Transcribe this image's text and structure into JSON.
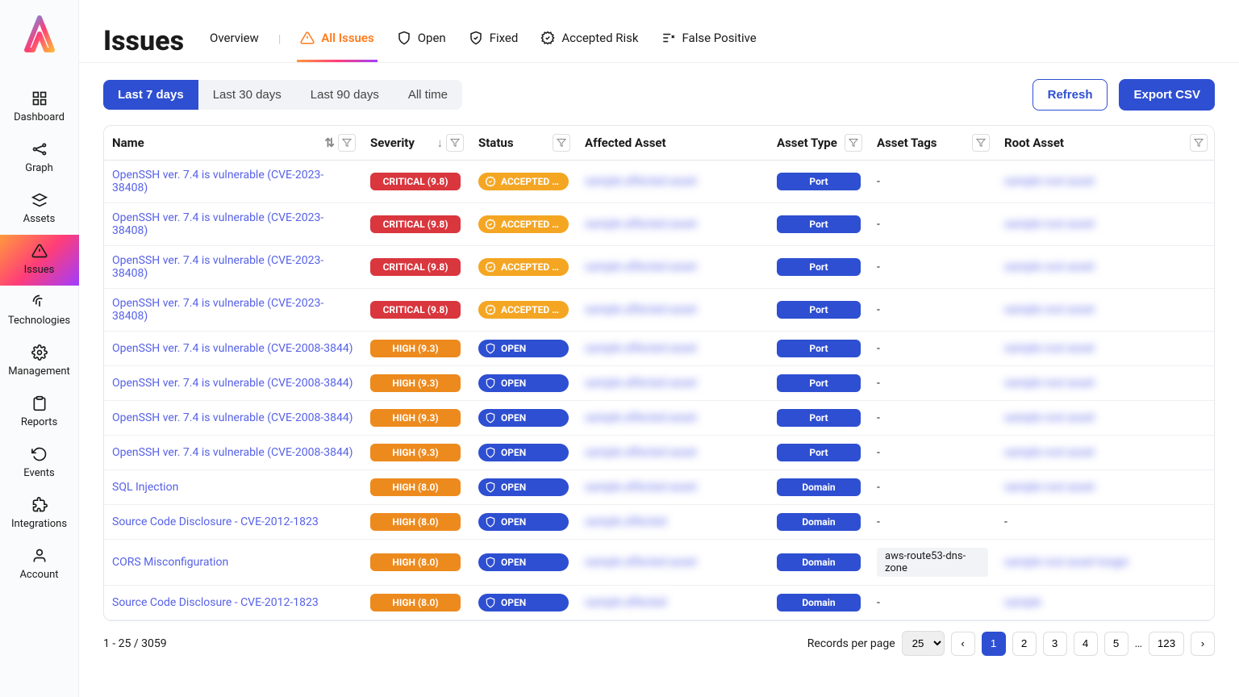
{
  "sidebar": {
    "items": [
      {
        "label": "Dashboard"
      },
      {
        "label": "Graph"
      },
      {
        "label": "Assets"
      },
      {
        "label": "Issues"
      },
      {
        "label": "Technologies"
      },
      {
        "label": "Management"
      },
      {
        "label": "Reports"
      },
      {
        "label": "Events"
      },
      {
        "label": "Integrations"
      },
      {
        "label": "Account"
      }
    ]
  },
  "page": {
    "title": "Issues"
  },
  "tabs": [
    {
      "label": "Overview"
    },
    {
      "label": "All Issues",
      "active": true
    },
    {
      "label": "Open"
    },
    {
      "label": "Fixed"
    },
    {
      "label": "Accepted Risk"
    },
    {
      "label": "False Positive"
    }
  ],
  "timefilters": [
    {
      "label": "Last 7 days",
      "active": true
    },
    {
      "label": "Last 30 days"
    },
    {
      "label": "Last 90 days"
    },
    {
      "label": "All time"
    }
  ],
  "buttons": {
    "refresh": "Refresh",
    "export": "Export CSV"
  },
  "columns": {
    "name": "Name",
    "severity": "Severity",
    "status": "Status",
    "affected": "Affected Asset",
    "asset_type": "Asset Type",
    "tags": "Asset Tags",
    "root": "Root Asset"
  },
  "rows": [
    {
      "name": "OpenSSH ver. 7.4 is vulnerable (CVE-2023-38408)",
      "sev": "CRITICAL (9.8)",
      "sevc": "crit",
      "status": "ACCEPTED …",
      "statc": "acc",
      "aff": "sample affected asset",
      "atype": "Port",
      "tags": "-",
      "root": "sample root asset"
    },
    {
      "name": "OpenSSH ver. 7.4 is vulnerable (CVE-2023-38408)",
      "sev": "CRITICAL (9.8)",
      "sevc": "crit",
      "status": "ACCEPTED …",
      "statc": "acc",
      "aff": "sample affected asset",
      "atype": "Port",
      "tags": "-",
      "root": "sample root asset"
    },
    {
      "name": "OpenSSH ver. 7.4 is vulnerable (CVE-2023-38408)",
      "sev": "CRITICAL (9.8)",
      "sevc": "crit",
      "status": "ACCEPTED …",
      "statc": "acc",
      "aff": "sample affected asset",
      "atype": "Port",
      "tags": "-",
      "root": "sample root asset"
    },
    {
      "name": "OpenSSH ver. 7.4 is vulnerable (CVE-2023-38408)",
      "sev": "CRITICAL (9.8)",
      "sevc": "crit",
      "status": "ACCEPTED …",
      "statc": "acc",
      "aff": "sample affected asset",
      "atype": "Port",
      "tags": "-",
      "root": "sample root asset"
    },
    {
      "name": "OpenSSH ver. 7.4 is vulnerable (CVE-2008-3844)",
      "sev": "HIGH (9.3)",
      "sevc": "high",
      "status": "OPEN",
      "statc": "open",
      "aff": "sample affected asset",
      "atype": "Port",
      "tags": "-",
      "root": "sample root asset"
    },
    {
      "name": "OpenSSH ver. 7.4 is vulnerable (CVE-2008-3844)",
      "sev": "HIGH (9.3)",
      "sevc": "high",
      "status": "OPEN",
      "statc": "open",
      "aff": "sample affected asset",
      "atype": "Port",
      "tags": "-",
      "root": "sample root asset"
    },
    {
      "name": "OpenSSH ver. 7.4 is vulnerable (CVE-2008-3844)",
      "sev": "HIGH (9.3)",
      "sevc": "high",
      "status": "OPEN",
      "statc": "open",
      "aff": "sample affected asset",
      "atype": "Port",
      "tags": "-",
      "root": "sample root asset"
    },
    {
      "name": "OpenSSH ver. 7.4 is vulnerable (CVE-2008-3844)",
      "sev": "HIGH (9.3)",
      "sevc": "high",
      "status": "OPEN",
      "statc": "open",
      "aff": "sample affected asset",
      "atype": "Port",
      "tags": "-",
      "root": "sample root asset"
    },
    {
      "name": "SQL Injection",
      "sev": "HIGH (8.0)",
      "sevc": "high",
      "status": "OPEN",
      "statc": "open",
      "aff": "sample affected asset",
      "atype": "Domain",
      "tags": "-",
      "root": "sample root asset"
    },
    {
      "name": "Source Code Disclosure - CVE-2012-1823",
      "sev": "HIGH (8.0)",
      "sevc": "high",
      "status": "OPEN",
      "statc": "open",
      "aff": "sample affected",
      "atype": "Domain",
      "tags": "-",
      "root": "-",
      "rootplain": true
    },
    {
      "name": "CORS Misconfiguration",
      "sev": "HIGH (8.0)",
      "sevc": "high",
      "status": "OPEN",
      "statc": "open",
      "aff": "sample affected asset",
      "atype": "Domain",
      "tags": "aws-route53-dns-zone",
      "root": "sample root asset longer"
    },
    {
      "name": "Source Code Disclosure - CVE-2012-1823",
      "sev": "HIGH (8.0)",
      "sevc": "high",
      "status": "OPEN",
      "statc": "open",
      "aff": "sample affected",
      "atype": "Domain",
      "tags": "-",
      "root": "sample"
    }
  ],
  "footer": {
    "range": "1 - 25 / 3059",
    "rpp_label": "Records per page",
    "rpp_value": "25",
    "pages": [
      "1",
      "2",
      "3",
      "4",
      "5"
    ],
    "last": "123"
  }
}
